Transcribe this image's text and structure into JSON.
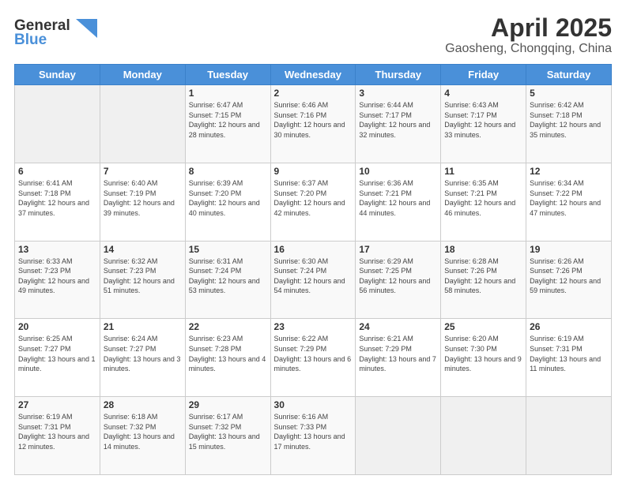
{
  "header": {
    "logo_line1": "General",
    "logo_line2": "Blue",
    "title": "April 2025",
    "location": "Gaosheng, Chongqing, China"
  },
  "days_of_week": [
    "Sunday",
    "Monday",
    "Tuesday",
    "Wednesday",
    "Thursday",
    "Friday",
    "Saturday"
  ],
  "weeks": [
    [
      {
        "day": "",
        "sunrise": "",
        "sunset": "",
        "daylight": ""
      },
      {
        "day": "",
        "sunrise": "",
        "sunset": "",
        "daylight": ""
      },
      {
        "day": "1",
        "sunrise": "Sunrise: 6:47 AM",
        "sunset": "Sunset: 7:15 PM",
        "daylight": "Daylight: 12 hours and 28 minutes."
      },
      {
        "day": "2",
        "sunrise": "Sunrise: 6:46 AM",
        "sunset": "Sunset: 7:16 PM",
        "daylight": "Daylight: 12 hours and 30 minutes."
      },
      {
        "day": "3",
        "sunrise": "Sunrise: 6:44 AM",
        "sunset": "Sunset: 7:17 PM",
        "daylight": "Daylight: 12 hours and 32 minutes."
      },
      {
        "day": "4",
        "sunrise": "Sunrise: 6:43 AM",
        "sunset": "Sunset: 7:17 PM",
        "daylight": "Daylight: 12 hours and 33 minutes."
      },
      {
        "day": "5",
        "sunrise": "Sunrise: 6:42 AM",
        "sunset": "Sunset: 7:18 PM",
        "daylight": "Daylight: 12 hours and 35 minutes."
      }
    ],
    [
      {
        "day": "6",
        "sunrise": "Sunrise: 6:41 AM",
        "sunset": "Sunset: 7:18 PM",
        "daylight": "Daylight: 12 hours and 37 minutes."
      },
      {
        "day": "7",
        "sunrise": "Sunrise: 6:40 AM",
        "sunset": "Sunset: 7:19 PM",
        "daylight": "Daylight: 12 hours and 39 minutes."
      },
      {
        "day": "8",
        "sunrise": "Sunrise: 6:39 AM",
        "sunset": "Sunset: 7:20 PM",
        "daylight": "Daylight: 12 hours and 40 minutes."
      },
      {
        "day": "9",
        "sunrise": "Sunrise: 6:37 AM",
        "sunset": "Sunset: 7:20 PM",
        "daylight": "Daylight: 12 hours and 42 minutes."
      },
      {
        "day": "10",
        "sunrise": "Sunrise: 6:36 AM",
        "sunset": "Sunset: 7:21 PM",
        "daylight": "Daylight: 12 hours and 44 minutes."
      },
      {
        "day": "11",
        "sunrise": "Sunrise: 6:35 AM",
        "sunset": "Sunset: 7:21 PM",
        "daylight": "Daylight: 12 hours and 46 minutes."
      },
      {
        "day": "12",
        "sunrise": "Sunrise: 6:34 AM",
        "sunset": "Sunset: 7:22 PM",
        "daylight": "Daylight: 12 hours and 47 minutes."
      }
    ],
    [
      {
        "day": "13",
        "sunrise": "Sunrise: 6:33 AM",
        "sunset": "Sunset: 7:23 PM",
        "daylight": "Daylight: 12 hours and 49 minutes."
      },
      {
        "day": "14",
        "sunrise": "Sunrise: 6:32 AM",
        "sunset": "Sunset: 7:23 PM",
        "daylight": "Daylight: 12 hours and 51 minutes."
      },
      {
        "day": "15",
        "sunrise": "Sunrise: 6:31 AM",
        "sunset": "Sunset: 7:24 PM",
        "daylight": "Daylight: 12 hours and 53 minutes."
      },
      {
        "day": "16",
        "sunrise": "Sunrise: 6:30 AM",
        "sunset": "Sunset: 7:24 PM",
        "daylight": "Daylight: 12 hours and 54 minutes."
      },
      {
        "day": "17",
        "sunrise": "Sunrise: 6:29 AM",
        "sunset": "Sunset: 7:25 PM",
        "daylight": "Daylight: 12 hours and 56 minutes."
      },
      {
        "day": "18",
        "sunrise": "Sunrise: 6:28 AM",
        "sunset": "Sunset: 7:26 PM",
        "daylight": "Daylight: 12 hours and 58 minutes."
      },
      {
        "day": "19",
        "sunrise": "Sunrise: 6:26 AM",
        "sunset": "Sunset: 7:26 PM",
        "daylight": "Daylight: 12 hours and 59 minutes."
      }
    ],
    [
      {
        "day": "20",
        "sunrise": "Sunrise: 6:25 AM",
        "sunset": "Sunset: 7:27 PM",
        "daylight": "Daylight: 13 hours and 1 minute."
      },
      {
        "day": "21",
        "sunrise": "Sunrise: 6:24 AM",
        "sunset": "Sunset: 7:27 PM",
        "daylight": "Daylight: 13 hours and 3 minutes."
      },
      {
        "day": "22",
        "sunrise": "Sunrise: 6:23 AM",
        "sunset": "Sunset: 7:28 PM",
        "daylight": "Daylight: 13 hours and 4 minutes."
      },
      {
        "day": "23",
        "sunrise": "Sunrise: 6:22 AM",
        "sunset": "Sunset: 7:29 PM",
        "daylight": "Daylight: 13 hours and 6 minutes."
      },
      {
        "day": "24",
        "sunrise": "Sunrise: 6:21 AM",
        "sunset": "Sunset: 7:29 PM",
        "daylight": "Daylight: 13 hours and 7 minutes."
      },
      {
        "day": "25",
        "sunrise": "Sunrise: 6:20 AM",
        "sunset": "Sunset: 7:30 PM",
        "daylight": "Daylight: 13 hours and 9 minutes."
      },
      {
        "day": "26",
        "sunrise": "Sunrise: 6:19 AM",
        "sunset": "Sunset: 7:31 PM",
        "daylight": "Daylight: 13 hours and 11 minutes."
      }
    ],
    [
      {
        "day": "27",
        "sunrise": "Sunrise: 6:19 AM",
        "sunset": "Sunset: 7:31 PM",
        "daylight": "Daylight: 13 hours and 12 minutes."
      },
      {
        "day": "28",
        "sunrise": "Sunrise: 6:18 AM",
        "sunset": "Sunset: 7:32 PM",
        "daylight": "Daylight: 13 hours and 14 minutes."
      },
      {
        "day": "29",
        "sunrise": "Sunrise: 6:17 AM",
        "sunset": "Sunset: 7:32 PM",
        "daylight": "Daylight: 13 hours and 15 minutes."
      },
      {
        "day": "30",
        "sunrise": "Sunrise: 6:16 AM",
        "sunset": "Sunset: 7:33 PM",
        "daylight": "Daylight: 13 hours and 17 minutes."
      },
      {
        "day": "",
        "sunrise": "",
        "sunset": "",
        "daylight": ""
      },
      {
        "day": "",
        "sunrise": "",
        "sunset": "",
        "daylight": ""
      },
      {
        "day": "",
        "sunrise": "",
        "sunset": "",
        "daylight": ""
      }
    ]
  ]
}
